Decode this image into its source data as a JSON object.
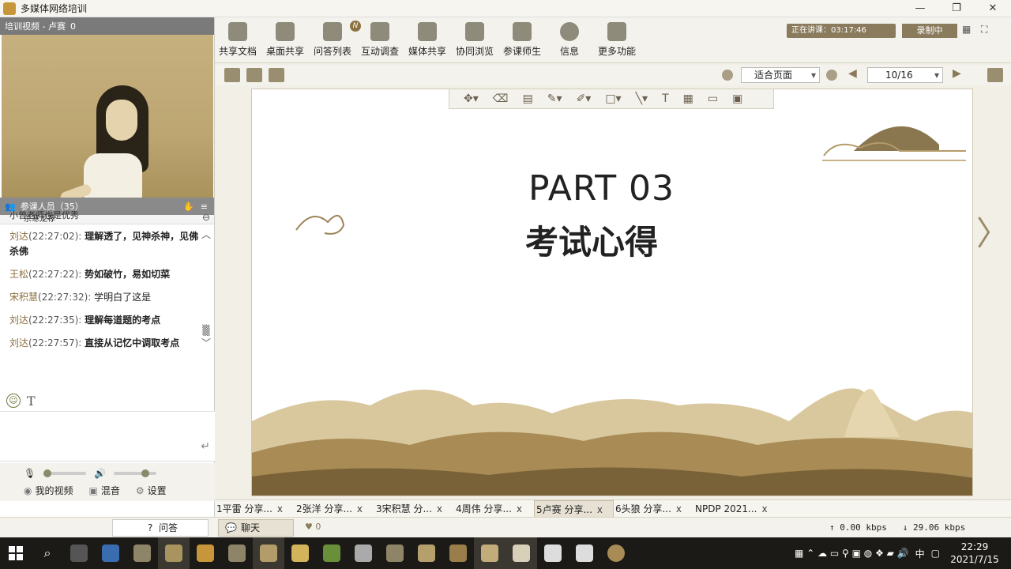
{
  "window": {
    "title": "多媒体网络培训"
  },
  "video_panel": {
    "header": "培训视频 - 卢赛",
    "header_count": "0",
    "members_label": "参课人员（35）",
    "speaker_strip": "杀寒龙荐"
  },
  "chat": {
    "cut_line": "小曾老师也是优秀",
    "messages": [
      {
        "who": "刘达",
        "time": "(22:27:02):",
        "text": "理解透了，见神杀神，见佛杀佛",
        "bold": true
      },
      {
        "who": "王松",
        "time": "(22:27:22):",
        "text": "势如破竹，易如切菜",
        "bold": true
      },
      {
        "who": "宋积慧",
        "time": "(22:27:32):",
        "text": "学明白了这是",
        "bold": false
      },
      {
        "who": "刘达",
        "time": "(22:27:35):",
        "text": "理解每道题的考点",
        "bold": true
      },
      {
        "who": "刘达",
        "time": "(22:27:57):",
        "text": "直接从记忆中调取考点",
        "bold": true
      }
    ],
    "input_value": "",
    "text_tool": "T"
  },
  "av": {
    "my_video": "我的视频",
    "mix": "混音",
    "settings": "设置",
    "mic_level": 0.0,
    "volume_level": 0.8
  },
  "toolbar": {
    "items": [
      "共享文档",
      "桌面共享",
      "问答列表",
      "互动调查",
      "媒体共享",
      "协同浏览",
      "参课师生",
      "信息",
      "更多功能"
    ],
    "status_text": "正在讲课：03:17:46",
    "record_label": "录制中"
  },
  "viewer": {
    "fit_label": "适合页面",
    "page_label": "10/16"
  },
  "slide": {
    "part": "PART 03",
    "heading": "考试心得"
  },
  "share_tabs": [
    {
      "label": "1平雷 分享...",
      "close": "x"
    },
    {
      "label": "2张洋 分享...",
      "close": "x"
    },
    {
      "label": "3宋积慧 分...",
      "close": "x"
    },
    {
      "label": "4周伟 分享...",
      "close": "x"
    },
    {
      "label": "5卢赛 分享...",
      "close": "x"
    },
    {
      "label": "6头狼 分享...",
      "close": "x"
    },
    {
      "label": "NPDP 2021...",
      "close": "x"
    }
  ],
  "status_bar": {
    "qa_label": "问答",
    "chat_label": "聊天",
    "likes": "0",
    "upload": "↑ 0.00 kbps",
    "download": "↓ 29.06 kbps"
  },
  "taskbar": {
    "time": "22:29",
    "date": "2021/7/15",
    "ime": "中"
  },
  "colors": {
    "accent": "#8a7340",
    "slide_bg": "#ffffff",
    "taskbar_bg": "#1b1a17"
  }
}
